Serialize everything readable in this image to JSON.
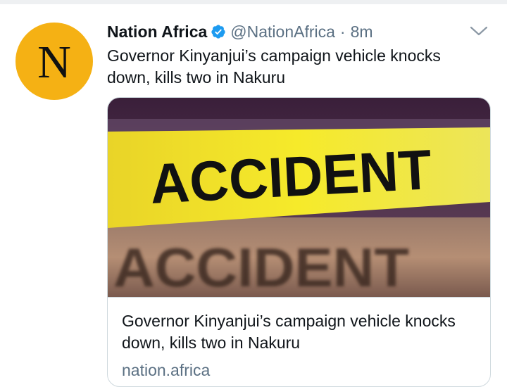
{
  "tweet": {
    "author_name": "Nation Africa",
    "handle": "@NationAfrica",
    "separator": "·",
    "timestamp": "8m",
    "avatar_letter": "N",
    "text": "Governor Kinyanjui’s campaign vehicle knocks down, kills two in Nakuru"
  },
  "card": {
    "image_text_primary": "ACCIDENT",
    "image_text_secondary": "ACCIDENT",
    "title": "Governor Kinyanjui’s campaign vehicle knocks down, kills two in Nakuru",
    "domain": "nation.africa"
  },
  "icons": {
    "verified": "verified-badge-icon",
    "more": "chevron-down-icon"
  },
  "colors": {
    "avatar_bg": "#f5b114",
    "verified_blue": "#1d9bf0",
    "secondary_text": "#5b7083",
    "card_border": "#cfd9de",
    "tape_yellow": "#f2e21e"
  }
}
